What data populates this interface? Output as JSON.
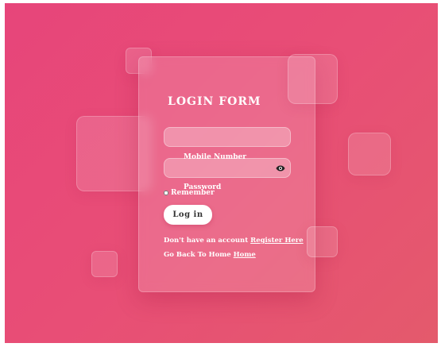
{
  "form": {
    "title": "LOGIN FORM",
    "mobile_label": "Mobile Number",
    "mobile_value": "",
    "password_label": "Password",
    "password_value": "",
    "remember_label": "Remember",
    "login_label": "Log in"
  },
  "links": {
    "account_text": "Don't have an account",
    "register_label": "Register Here",
    "home_text": "Go Back To Home",
    "home_label": "Home"
  },
  "icons": {
    "password_toggle": "eye-icon"
  },
  "colors": {
    "bg_start": "#e7457a",
    "bg_end": "#e45a6c",
    "text": "#ffffff",
    "button_bg": "#ffffff"
  }
}
